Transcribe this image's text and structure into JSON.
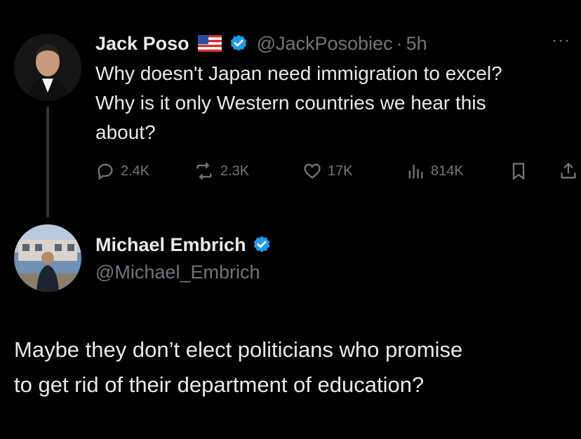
{
  "tweet": {
    "author_name": "Jack Poso",
    "flag_icon": "us-flag-icon",
    "verified_color": "#1d9bf0",
    "handle": "@JackPosobiec",
    "separator": "·",
    "time": "5h",
    "more_label": "···",
    "text": "Why doesn't Japan need immigration to excel?\nWhy is it only Western countries we hear this\nabout?",
    "actions": {
      "replies": "2.4K",
      "reposts": "2.3K",
      "likes": "17K",
      "views": "814K"
    }
  },
  "reply": {
    "author_name": "Michael Embrich",
    "handle": "@Michael_Embrich",
    "text": "Maybe they don’t elect politicians who promise\nto get rid of their department of education?"
  },
  "colors": {
    "background": "#000000",
    "text": "#e7e9ea",
    "muted": "#71767b",
    "accent": "#1d9bf0"
  }
}
